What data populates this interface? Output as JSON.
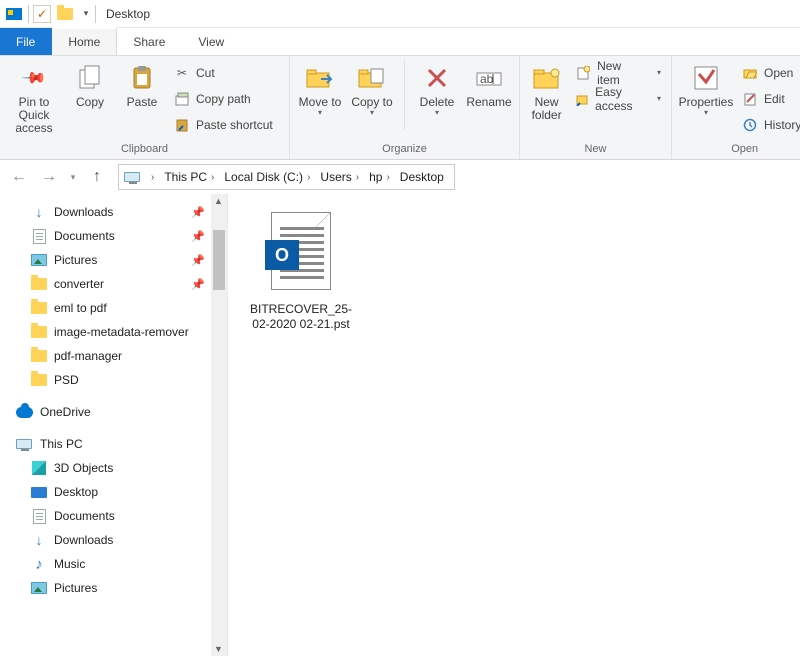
{
  "title": "Desktop",
  "tabs": {
    "file": "File",
    "home": "Home",
    "share": "Share",
    "view": "View"
  },
  "ribbon": {
    "pin": "Pin to Quick access",
    "copy": "Copy",
    "paste": "Paste",
    "cut": "Cut",
    "copypath": "Copy path",
    "pasteshort": "Paste shortcut",
    "moveto": "Move to",
    "copyto": "Copy to",
    "delete": "Delete",
    "rename": "Rename",
    "newfolder": "New folder",
    "newitem": "New item",
    "easyaccess": "Easy access",
    "properties": "Properties",
    "open": "Open",
    "edit": "Edit",
    "history": "History",
    "grp_clip": "Clipboard",
    "grp_org": "Organize",
    "grp_new": "New",
    "grp_open": "Open"
  },
  "breadcrumb": [
    "This PC",
    "Local Disk (C:)",
    "Users",
    "hp",
    "Desktop"
  ],
  "tree": {
    "quick": [
      {
        "label": "Downloads",
        "pin": true,
        "icon": "dl"
      },
      {
        "label": "Documents",
        "pin": true,
        "icon": "doc"
      },
      {
        "label": "Pictures",
        "pin": true,
        "icon": "img"
      },
      {
        "label": "converter",
        "pin": true,
        "icon": "folder"
      },
      {
        "label": "eml to pdf",
        "pin": false,
        "icon": "folder"
      },
      {
        "label": "image-metadata-remover",
        "pin": false,
        "icon": "folder"
      },
      {
        "label": "pdf-manager",
        "pin": false,
        "icon": "folder"
      },
      {
        "label": "PSD",
        "pin": false,
        "icon": "folder"
      }
    ],
    "onedrive": "OneDrive",
    "thispc": "This PC",
    "pcitems": [
      {
        "label": "3D Objects",
        "icon": "cube"
      },
      {
        "label": "Desktop",
        "icon": "desk"
      },
      {
        "label": "Documents",
        "icon": "doc"
      },
      {
        "label": "Downloads",
        "icon": "dl"
      },
      {
        "label": "Music",
        "icon": "music"
      },
      {
        "label": "Pictures",
        "icon": "img"
      }
    ]
  },
  "file": {
    "name": "BITRECOVER_25-02-2020 02-21.pst"
  }
}
